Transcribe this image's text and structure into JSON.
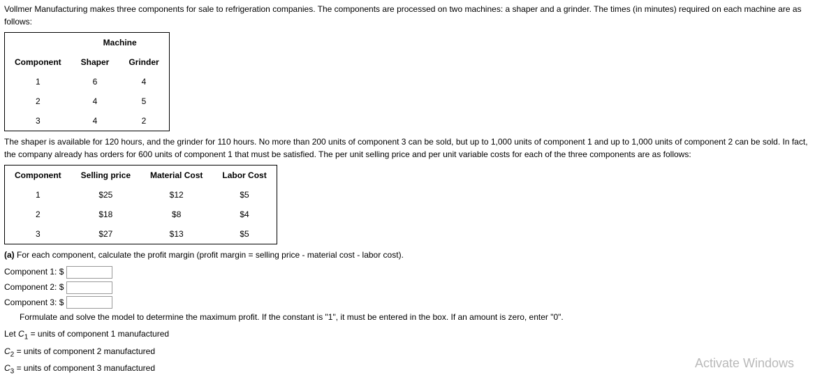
{
  "intro": {
    "p1": "Vollmer Manufacturing makes three components for sale to refrigeration companies. The components are processed on two machines: a shaper and a grinder. The times (in minutes) required on each machine are as follows:",
    "p2": "The shaper is available for 120 hours, and the grinder for 110 hours. No more than 200 units of component 3 can be sold, but up to 1,000 units of component 1 and up to 1,000 units of component 2 can be sold. In fact, the company already has orders for 600 units of component 1 that must be satisfied. The per unit selling price and per unit variable costs for each of the three components are as follows:"
  },
  "machine_table": {
    "super": "Machine",
    "h_component": "Component",
    "h_shaper": "Shaper",
    "h_grinder": "Grinder",
    "rows": [
      {
        "comp": "1",
        "shaper": "6",
        "grinder": "4"
      },
      {
        "comp": "2",
        "shaper": "4",
        "grinder": "5"
      },
      {
        "comp": "3",
        "shaper": "4",
        "grinder": "2"
      }
    ]
  },
  "price_table": {
    "h_component": "Component",
    "h_price": "Selling price",
    "h_material": "Material Cost",
    "h_labor": "Labor Cost",
    "rows": [
      {
        "comp": "1",
        "price": "$25",
        "material": "$12",
        "labor": "$5"
      },
      {
        "comp": "2",
        "price": "$18",
        "material": "$8",
        "labor": "$4"
      },
      {
        "comp": "3",
        "price": "$27",
        "material": "$13",
        "labor": "$5"
      }
    ]
  },
  "part_a": {
    "prompt_lead": "(a) ",
    "prompt": "For each component, calculate the profit margin (profit margin = selling price - material cost - labor cost).",
    "c1_label": "Component 1: $",
    "c2_label": "Component 2: $",
    "c3_label": "Component 3: $",
    "formulate": "Formulate and solve the model to determine the maximum profit. If the constant is \"1\", it must be entered in the box. If an amount is zero, enter \"0\".",
    "let": "Let ",
    "c1_def": " = units of component 1 manufactured",
    "c2_def": " = units of component 2 manufactured",
    "c3_def": " = units of component 3 manufactured"
  },
  "watermark": "Activate Windows"
}
